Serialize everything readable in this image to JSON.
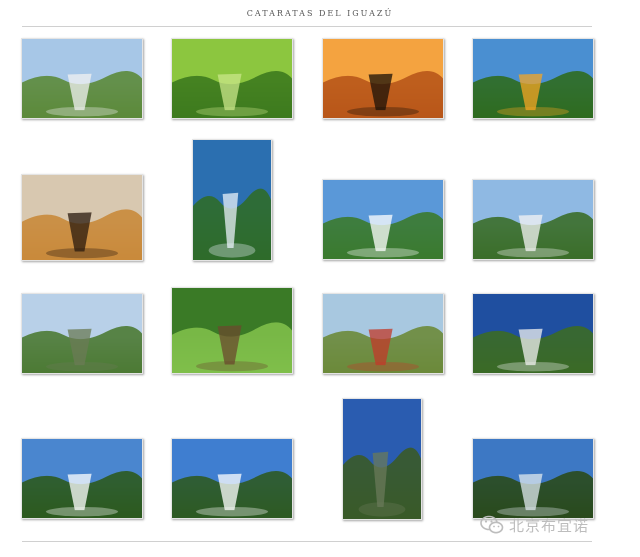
{
  "page": {
    "title": "CATARATAS DEL IGUAZÚ"
  },
  "gallery": {
    "items": [
      {
        "name": "falls-overview-1",
        "palette": [
          "#a7c7e7",
          "#5c8a3a",
          "#f2f2f2"
        ]
      },
      {
        "name": "butterfly-leaves",
        "palette": [
          "#8cc63f",
          "#3d7a1e",
          "#c9e58a"
        ]
      },
      {
        "name": "sunset-birds",
        "palette": [
          "#f4a340",
          "#b8561a",
          "#1b1208"
        ]
      },
      {
        "name": "toucan-tree",
        "palette": [
          "#4a8fd1",
          "#2f6b1f",
          "#f5a623"
        ]
      },
      {
        "name": "jaguar",
        "palette": [
          "#d8c8b0",
          "#c98a3b",
          "#2a1a0e"
        ]
      },
      {
        "name": "aerial-river",
        "palette": [
          "#2b6fb0",
          "#2f6b2a",
          "#e8f0f8"
        ]
      },
      {
        "name": "falls-walkway-1",
        "palette": [
          "#5a98d8",
          "#3b7a2e",
          "#ffffff"
        ]
      },
      {
        "name": "falls-walkway-2",
        "palette": [
          "#8fb9e3",
          "#3b6e29",
          "#f4f4f4"
        ]
      },
      {
        "name": "falls-river-view",
        "palette": [
          "#b8d0e8",
          "#4c7a34",
          "#6b7b55"
        ]
      },
      {
        "name": "monkey-leaves",
        "palette": [
          "#3a7a26",
          "#7fbf4a",
          "#6b4a2e"
        ]
      },
      {
        "name": "tourist-train",
        "palette": [
          "#a8c8e0",
          "#6b8a3a",
          "#c23a2a"
        ]
      },
      {
        "name": "falls-blue-sky",
        "palette": [
          "#1f4fa0",
          "#3b6a26",
          "#f0f0f0"
        ]
      },
      {
        "name": "falls-clouds-1",
        "palette": [
          "#4a86cf",
          "#2c5a1e",
          "#ffffff"
        ]
      },
      {
        "name": "falls-clouds-2",
        "palette": [
          "#3f7ed0",
          "#2e5a22",
          "#ffffff"
        ]
      },
      {
        "name": "falls-portrait",
        "palette": [
          "#2a5cb0",
          "#3a5a28",
          "#6a7a5a"
        ]
      },
      {
        "name": "falls-canyon",
        "palette": [
          "#3d78c4",
          "#2a4a1c",
          "#dfe8ee"
        ]
      }
    ]
  },
  "watermark": {
    "text": "北京布宜诺",
    "icon": "wechat-icon",
    "color": "#bdbdbd"
  }
}
